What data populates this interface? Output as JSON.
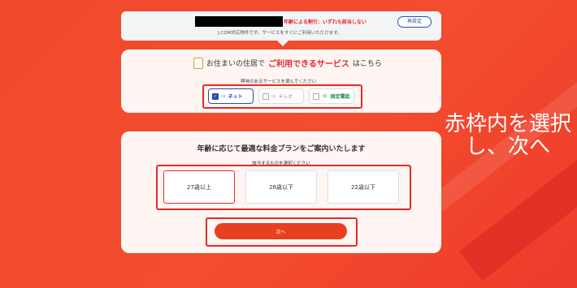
{
  "top_card": {
    "discount_text": "年齢による割引：いずれも該当しない",
    "subnote": "J:COM対応物件です。サービスをすぐにご利用いただけます。",
    "reset_button": "再設定"
  },
  "service_card": {
    "heading_prefix": "お住まいの住居で",
    "heading_accent": "ご利用できるサービス",
    "heading_suffix": "はこちら",
    "subheading": "興味のあるサービスを選んでください",
    "options": [
      {
        "label": "ネット",
        "checked": true
      },
      {
        "label": "テレビ",
        "checked": false
      },
      {
        "label": "固定電話",
        "checked": false
      }
    ]
  },
  "age_card": {
    "title": "年齢に応じて最適な料金プランをご案内いたします",
    "subtitle": "該当するものを選択ください",
    "options": [
      "27歳以上",
      "26歳以下",
      "22歳以下"
    ],
    "selected_index": 0,
    "next_button": "次へ"
  },
  "overlay": {
    "line1": "赤枠内を選択",
    "line2": "し、次へ"
  },
  "colors": {
    "background": "#f04a2e",
    "accent_red": "#e4292a",
    "net_blue": "#2b4ea8",
    "tv_pink": "#e04090",
    "phone_green": "#1f8a4c"
  }
}
